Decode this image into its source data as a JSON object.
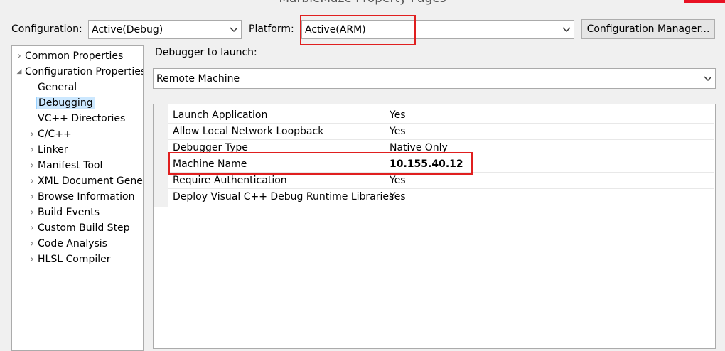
{
  "window": {
    "title": "MarbleMaze Property Pages"
  },
  "header": {
    "configuration_label": "Configuration:",
    "configuration_value": "Active(Debug)",
    "platform_label": "Platform:",
    "platform_value": "Active(ARM)",
    "config_manager_button": "Configuration Manager..."
  },
  "tree": {
    "items": [
      {
        "label": "Common Properties",
        "expander": "›"
      },
      {
        "label": "Configuration Properties",
        "expander": "◢"
      },
      {
        "label": "General",
        "expander": ""
      },
      {
        "label": "Debugging",
        "expander": ""
      },
      {
        "label": "VC++ Directories",
        "expander": ""
      },
      {
        "label": "C/C++",
        "expander": "›"
      },
      {
        "label": "Linker",
        "expander": "›"
      },
      {
        "label": "Manifest Tool",
        "expander": "›"
      },
      {
        "label": "XML Document Generator",
        "expander": "›"
      },
      {
        "label": "Browse Information",
        "expander": "›"
      },
      {
        "label": "Build Events",
        "expander": "›"
      },
      {
        "label": "Custom Build Step",
        "expander": "›"
      },
      {
        "label": "Code Analysis",
        "expander": "›"
      },
      {
        "label": "HLSL Compiler",
        "expander": "›"
      }
    ]
  },
  "debugger": {
    "label": "Debugger to launch:",
    "value": "Remote Machine"
  },
  "properties": {
    "rows": [
      {
        "name": "Launch Application",
        "value": "Yes"
      },
      {
        "name": "Allow Local Network Loopback",
        "value": "Yes"
      },
      {
        "name": "Debugger Type",
        "value": "Native Only"
      },
      {
        "name": "Machine Name",
        "value": "10.155.40.12"
      },
      {
        "name": "Require Authentication",
        "value": "Yes"
      },
      {
        "name": "Deploy Visual C++ Debug Runtime Libraries",
        "value": "Yes"
      }
    ]
  },
  "icons": {
    "dropdown": "chevron-down-icon",
    "collapsed": "chevron-right-icon",
    "expanded": "triangle-expanded-icon"
  },
  "colors": {
    "highlight": "#e01f1f",
    "selection": "#cce8ff"
  }
}
